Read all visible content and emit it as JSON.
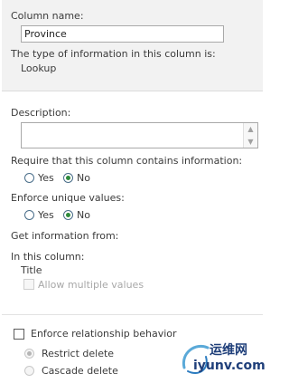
{
  "column_name": {
    "label": "Column name:",
    "value": "Province"
  },
  "type_info": {
    "label": "The type of information in this column is:",
    "value": "Lookup"
  },
  "description": {
    "label": "Description:",
    "value": ""
  },
  "require": {
    "label": "Require that this column contains information:",
    "options": [
      {
        "label": "Yes",
        "checked": false
      },
      {
        "label": "No",
        "checked": true
      }
    ]
  },
  "unique": {
    "label": "Enforce unique values:",
    "options": [
      {
        "label": "Yes",
        "checked": false
      },
      {
        "label": "No",
        "checked": true
      }
    ]
  },
  "get_info": {
    "label": "Get information from:"
  },
  "in_column": {
    "label": "In this column:",
    "value": "Title"
  },
  "allow_multiple": {
    "label": "Allow multiple values",
    "checked": false,
    "enabled": false
  },
  "relationship": {
    "label": "Enforce relationship behavior",
    "checked": false,
    "options": [
      {
        "label": "Restrict delete",
        "checked": true,
        "enabled": false
      },
      {
        "label": "Cascade delete",
        "checked": false,
        "enabled": false
      }
    ]
  },
  "watermark": {
    "brand": "运维网",
    "url": "iyunv.com"
  }
}
